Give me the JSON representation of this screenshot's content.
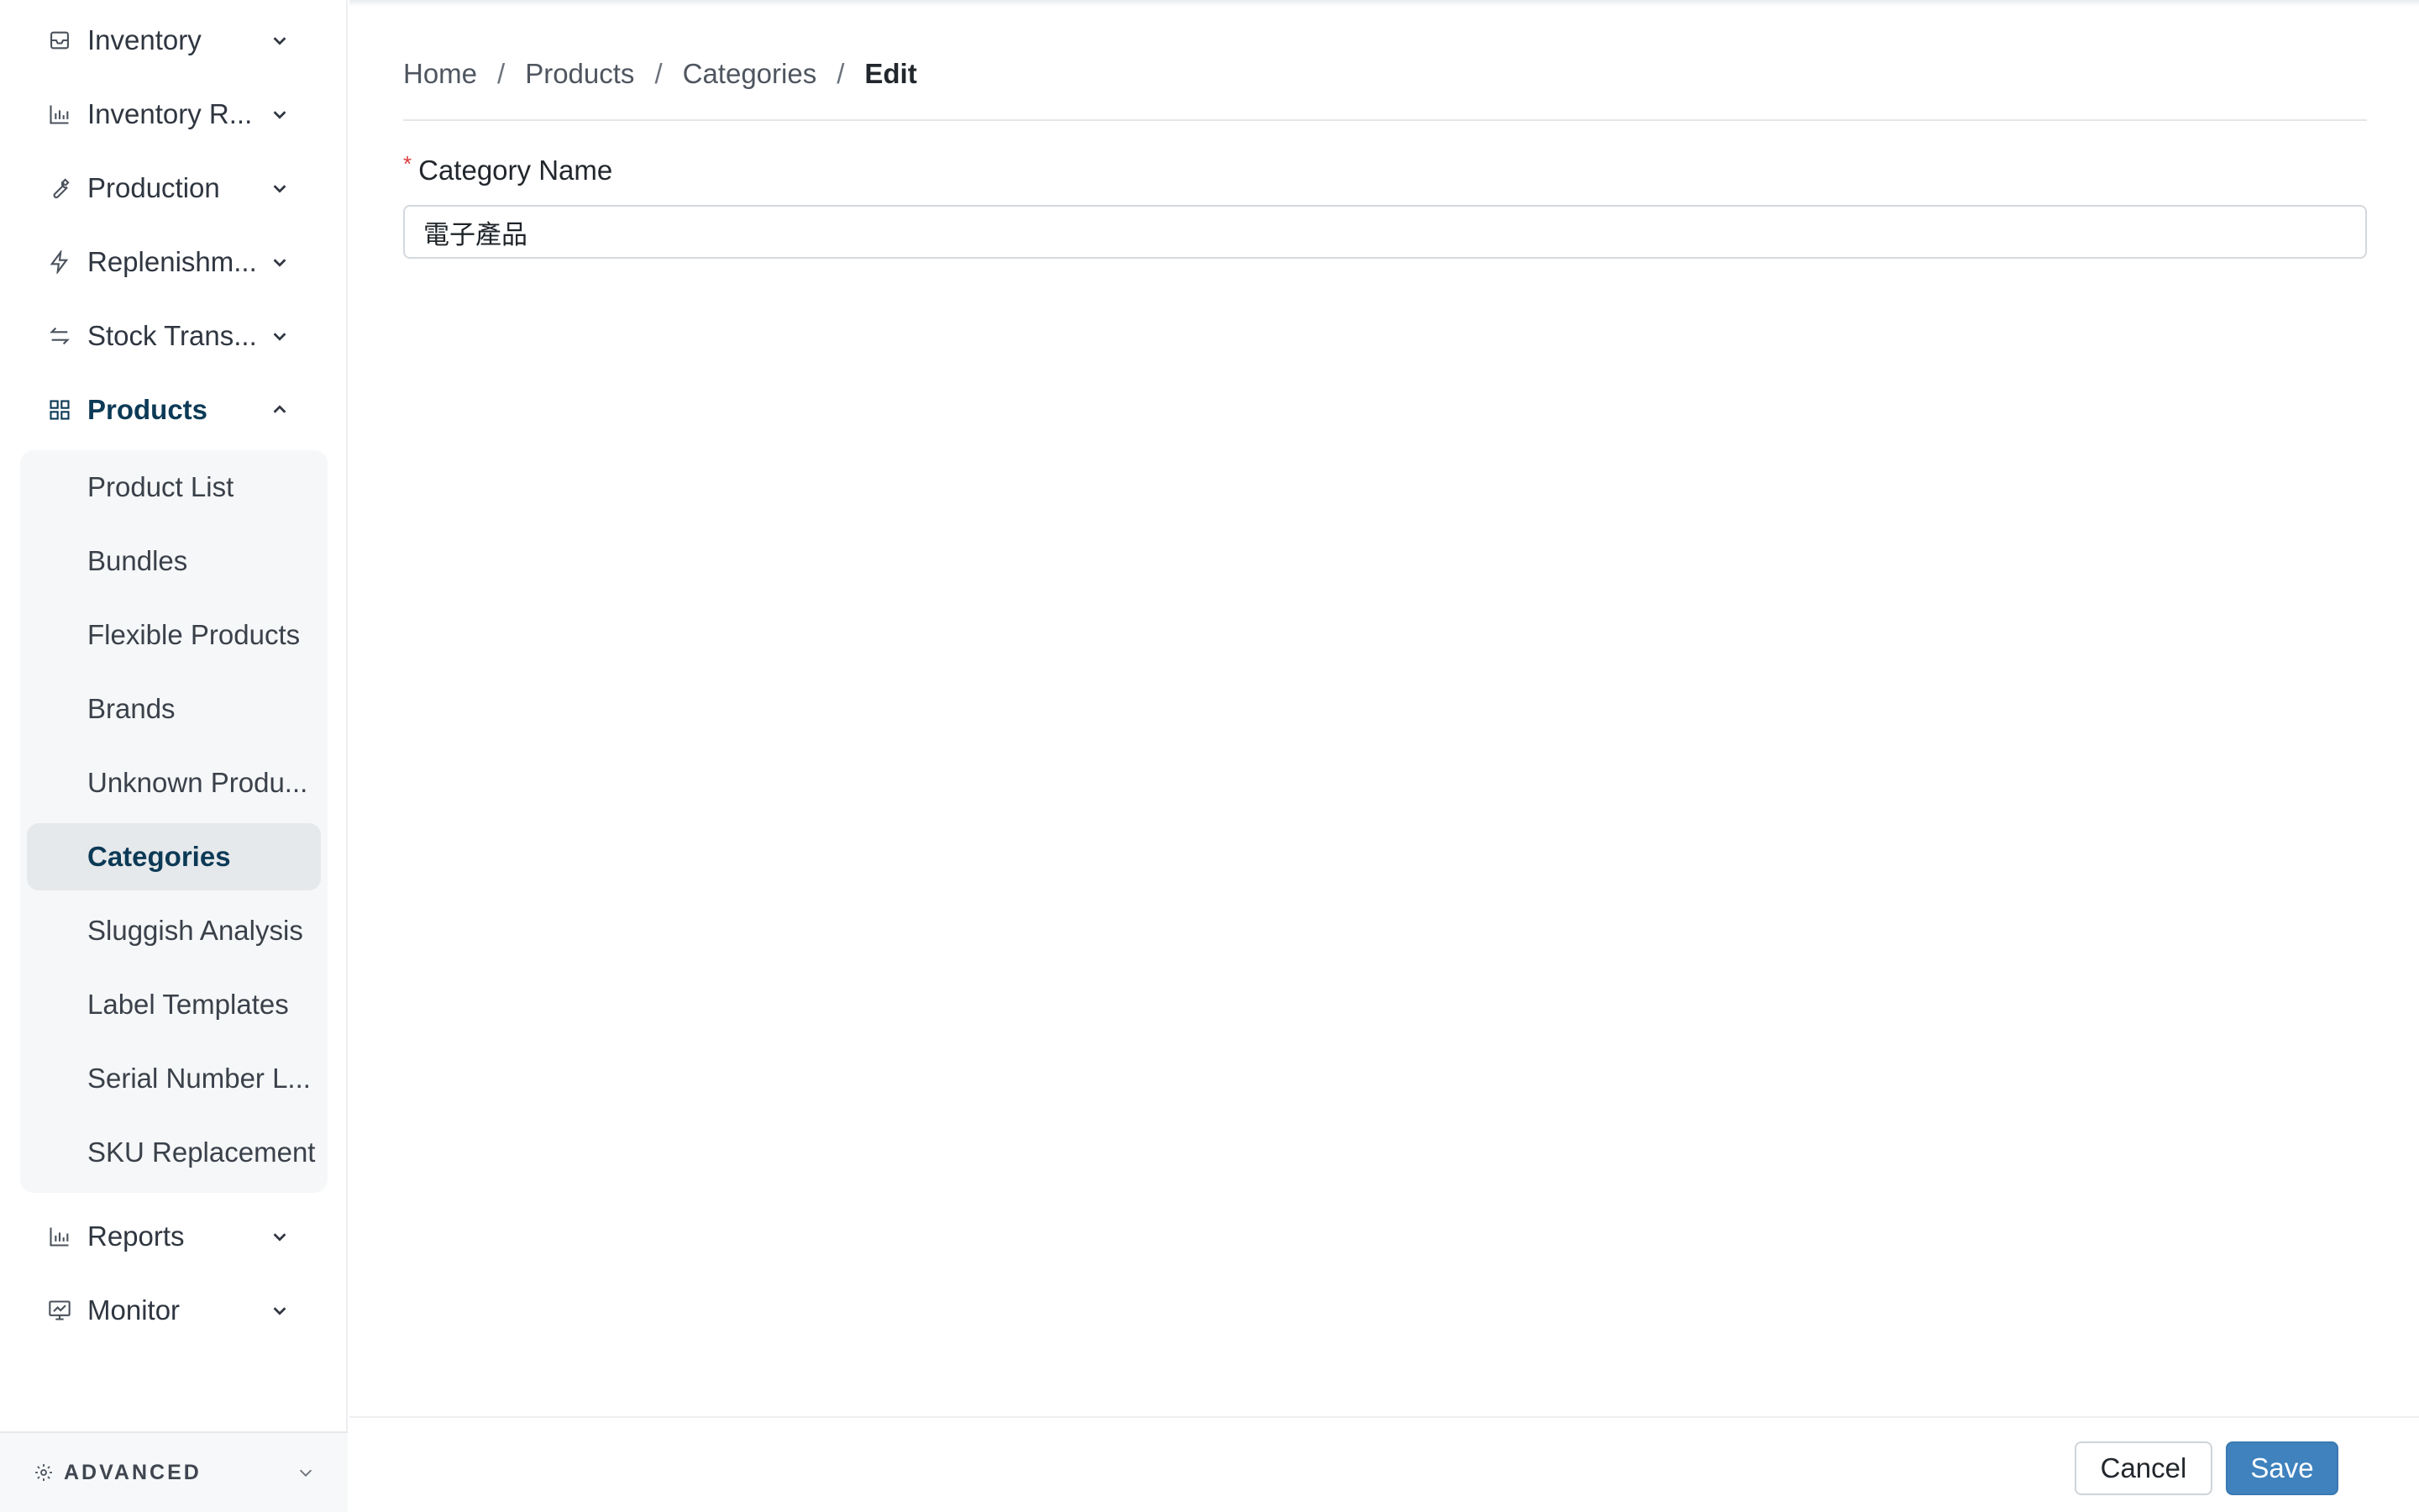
{
  "sidebar": {
    "items": [
      {
        "label": "Inventory",
        "icon": "inbox-icon",
        "expanded": false
      },
      {
        "label": "Inventory R...",
        "icon": "bar-chart-icon",
        "expanded": false
      },
      {
        "label": "Production",
        "icon": "wrench-icon",
        "expanded": false
      },
      {
        "label": "Replenishm...",
        "icon": "lightning-icon",
        "expanded": false
      },
      {
        "label": "Stock Trans...",
        "icon": "swap-icon",
        "expanded": false
      },
      {
        "label": "Products",
        "icon": "grid-icon",
        "expanded": true,
        "active": true
      },
      {
        "label": "Reports",
        "icon": "bar-chart-icon",
        "expanded": false
      },
      {
        "label": "Monitor",
        "icon": "monitor-icon",
        "expanded": false
      }
    ],
    "products_submenu": [
      {
        "label": "Product List"
      },
      {
        "label": "Bundles"
      },
      {
        "label": "Flexible Products"
      },
      {
        "label": "Brands"
      },
      {
        "label": "Unknown Produ..."
      },
      {
        "label": "Categories",
        "active": true
      },
      {
        "label": "Sluggish Analysis"
      },
      {
        "label": "Label Templates"
      },
      {
        "label": "Serial Number L..."
      },
      {
        "label": "SKU Replacement"
      }
    ],
    "advanced_label": "ADVANCED"
  },
  "breadcrumb": {
    "items": [
      "Home",
      "Products",
      "Categories",
      "Edit"
    ],
    "separator": "/"
  },
  "form": {
    "required_mark": "*",
    "category_name_label": "Category Name",
    "category_name_value": "電子產品"
  },
  "footer": {
    "cancel_label": "Cancel",
    "save_label": "Save"
  },
  "colors": {
    "accent": "#3f82be",
    "active_text": "#0c3a56",
    "required": "#e03a3a"
  }
}
